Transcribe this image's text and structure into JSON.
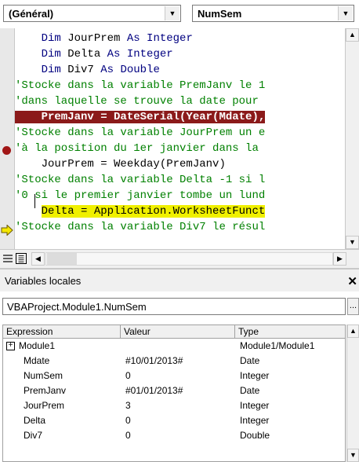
{
  "code_window": {
    "object_combo": "(Général)",
    "procedure_combo": "NumSem",
    "lines": [
      {
        "indent": "    ",
        "kind": "decl",
        "keyword1": "Dim",
        "name": " JourPrem ",
        "keyword2": "As Integer"
      },
      {
        "indent": "    ",
        "kind": "decl",
        "keyword1": "Dim",
        "name": " Delta ",
        "keyword2": "As Integer"
      },
      {
        "indent": "    ",
        "kind": "decl",
        "keyword1": "Dim",
        "name": " Div7 ",
        "keyword2": "As Double"
      },
      {
        "kind": "comment",
        "text": "'Stocke dans la variable PremJanv le 1"
      },
      {
        "kind": "comment",
        "text": "'dans laquelle se trouve la date pour"
      },
      {
        "kind": "breakpoint",
        "text": "    PremJanv = DateSerial(Year(Mdate),"
      },
      {
        "kind": "comment",
        "text": "'Stocke dans la variable JourPrem un e"
      },
      {
        "kind": "comment",
        "text": "'à la position du 1er janvier dans la"
      },
      {
        "kind": "code",
        "text": "    JourPrem = Weekday(PremJanv)"
      },
      {
        "kind": "comment",
        "text": "'Stocke dans la variable Delta -1 si l"
      },
      {
        "kind": "comment",
        "text": "'0 si le premier janvier tombe un lund"
      },
      {
        "kind": "current",
        "indent": "    ",
        "text": "Delta = Application.WorksheetFunct"
      },
      {
        "kind": "comment",
        "text": "'Stocke dans la variable Div7 le résul"
      }
    ],
    "icons": {
      "breakpoint": "breakpoint-dot-icon",
      "current_line": "execution-arrow-icon"
    },
    "colors": {
      "keyword": "#000080",
      "comment": "#008000",
      "breakpoint_bg": "#8b1a1a",
      "current_line_bg": "#f0f000"
    }
  },
  "locals_window": {
    "title": "Variables locales",
    "context": "VBAProject.Module1.NumSem",
    "more_button": "...",
    "columns": [
      "Expression",
      "Valeur",
      "Type"
    ],
    "rows": [
      {
        "expression": "Module1",
        "value": "",
        "type": "Module1/Module1",
        "expandable": true
      },
      {
        "expression": "Mdate",
        "value": "#10/01/2013#",
        "type": "Date"
      },
      {
        "expression": "NumSem",
        "value": "0",
        "type": "Integer"
      },
      {
        "expression": "PremJanv",
        "value": "#01/01/2013#",
        "type": "Date"
      },
      {
        "expression": "JourPrem",
        "value": "3",
        "type": "Integer"
      },
      {
        "expression": "Delta",
        "value": "0",
        "type": "Integer"
      },
      {
        "expression": "Div7",
        "value": "0",
        "type": "Double"
      }
    ],
    "expander_symbol": "+"
  }
}
